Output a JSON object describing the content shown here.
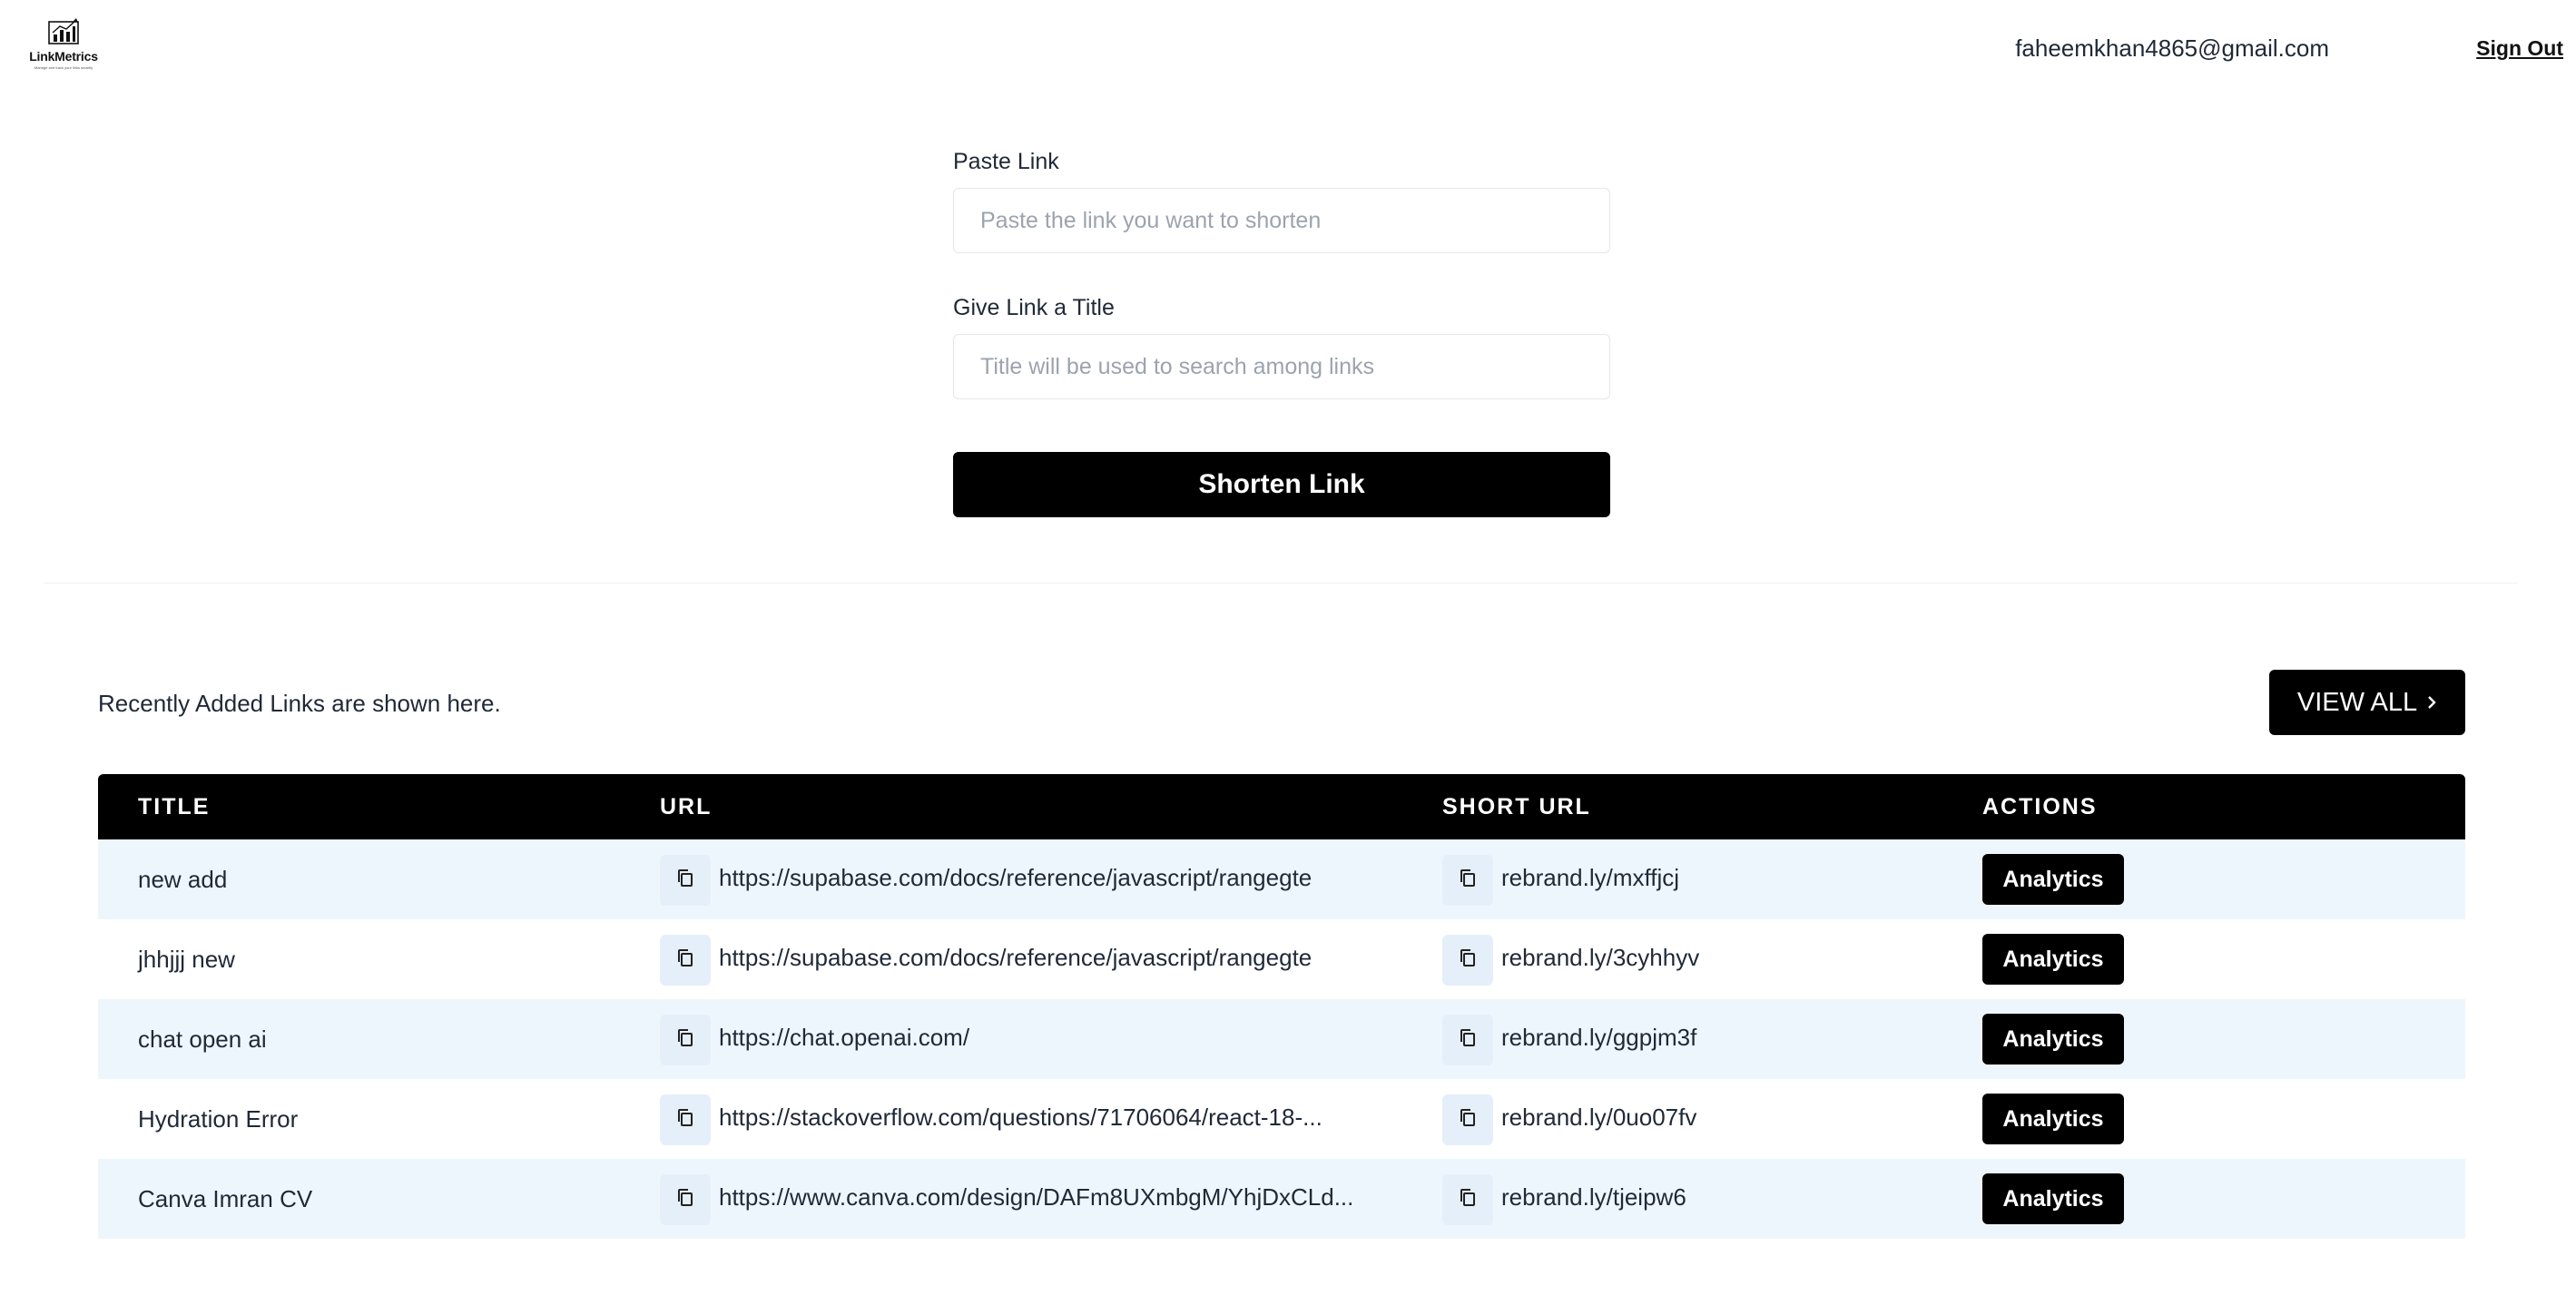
{
  "brand": {
    "name": "LinkMetrics",
    "tagline": "Manage and track your links smartly",
    "logo_icon": "bar-chart-logo-icon"
  },
  "header": {
    "user_email": "faheemkhan4865@gmail.com",
    "sign_out_label": "Sign Out"
  },
  "form": {
    "paste_label": "Paste Link",
    "paste_placeholder": "Paste the link you want to shorten",
    "paste_value": "",
    "title_label": "Give Link a Title",
    "title_placeholder": "Title will be used to search among links",
    "title_value": "",
    "submit_label": "Shorten Link"
  },
  "recent": {
    "caption": "Recently Added Links are shown here.",
    "view_all_label": "VIEW ALL",
    "view_all_icon": "chevron-right-icon"
  },
  "table": {
    "headers": {
      "title": "TITLE",
      "url": "URL",
      "short_url": "SHORT URL",
      "actions": "ACTIONS"
    },
    "copy_icon": "copy-icon",
    "action_label": "Analytics",
    "rows": [
      {
        "title": "new add",
        "url": "https://supabase.com/docs/reference/javascript/rangegte",
        "short_url": "rebrand.ly/mxffjcj"
      },
      {
        "title": "jhhjjj new",
        "url": "https://supabase.com/docs/reference/javascript/rangegte",
        "short_url": "rebrand.ly/3cyhhyv"
      },
      {
        "title": "chat open ai",
        "url": "https://chat.openai.com/",
        "short_url": "rebrand.ly/ggpjm3f"
      },
      {
        "title": "Hydration Error",
        "url": "https://stackoverflow.com/questions/71706064/react-18-...",
        "short_url": "rebrand.ly/0uo07fv"
      },
      {
        "title": "Canva Imran CV",
        "url": "https://www.canva.com/design/DAFm8UXmbgM/YhjDxCLd...",
        "short_url": "rebrand.ly/tjeipw6"
      }
    ]
  }
}
